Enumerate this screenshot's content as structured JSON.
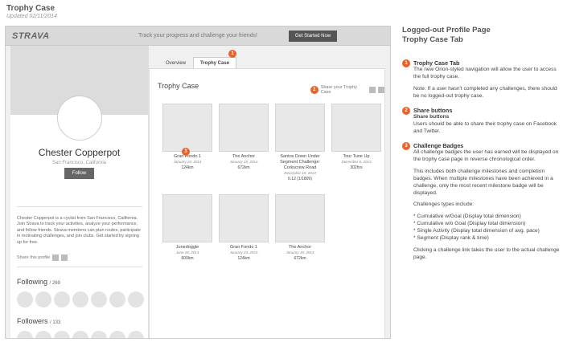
{
  "doc": {
    "title": "Trophy Case",
    "updated": "Updated 02/11/2014"
  },
  "header": {
    "logo": "STRAVA",
    "tagline": "Track your progress and challenge your friends!",
    "cta_label": "Get Started Now"
  },
  "profile": {
    "name": "Chester Copperpot",
    "location": "San Francisco, California",
    "follow_label": "Follow",
    "bio": "Chester Copperpot is a cyclist from San Francisco, California. Join Strava to track your activities, analyze your performance, and follow friends. Strava members can plan routes, participate in motivating challenges, and join clubs. Get started by signing up for free.",
    "share_label": "Share this profile",
    "following_label": "Following",
    "following_count": "/ 269",
    "followers_label": "Followers",
    "followers_count": "/ 133"
  },
  "tabs": [
    "Overview",
    "Trophy Case"
  ],
  "trophy_case": {
    "title": "Trophy Case",
    "share_label": "Share your Trophy Case",
    "badges": [
      {
        "name": "Gran Fondo 1",
        "date": "January 24, 2014",
        "stat": "124km"
      },
      {
        "name": "The Anchor",
        "date": "January 19, 2014",
        "stat": "672km"
      },
      {
        "name": "Santos Down Under Segment Challenge: Corkscrew Road",
        "date": "December 10, 2013",
        "stat": "6.12 (1/1809)"
      },
      {
        "name": "Tour Tune Up",
        "date": "December 6, 2013",
        "stat": "302hrs"
      },
      {
        "name": "Junedoggle",
        "date": "June 28, 2013",
        "stat": "600km"
      },
      {
        "name": "Gran Fondo 1",
        "date": "January 24, 2014",
        "stat": "124km"
      },
      {
        "name": "The Anchor",
        "date": "January 19, 2014",
        "stat": "672km"
      }
    ]
  },
  "notes": {
    "title": "Logged-out Profile Page",
    "subtitle": "Trophy Case Tab",
    "items": [
      {
        "num": "1",
        "heading": "Trophy Case Tab",
        "paras": [
          "The new Orion-styled navigation will allow the user to access the full trophy case.",
          "Note: If a user hasn't completed any challenges, there should be no logged-out trophy case."
        ]
      },
      {
        "num": "2",
        "heading": "Share buttons",
        "paras": [
          "Share buttons",
          "Users should be able to share their trophy case on Facebook and Twitter."
        ]
      },
      {
        "num": "3",
        "heading": "Challenge Badges",
        "paras": [
          "All challenge badges the user has earned will be displayed on the trophy case page in reverse chronological order.",
          "This includes both challenge milestones and completion badges. When multiple milestones have been achieved in a challenge, only the most recent milestone badge will be displayed.",
          "Challenges types include:",
          "* Cumulative w/Goal (Display total dimension)\n* Cumulative w/o Goal (Display total dimension)\n* Single Activity (Display total dimension of avg. pace)\n* Segment (Display rank & time)",
          "Clicking a challenge link takes the user to the actual challenge page."
        ]
      }
    ]
  },
  "colors": {
    "accent": "#e8622c",
    "button": "#555555"
  }
}
